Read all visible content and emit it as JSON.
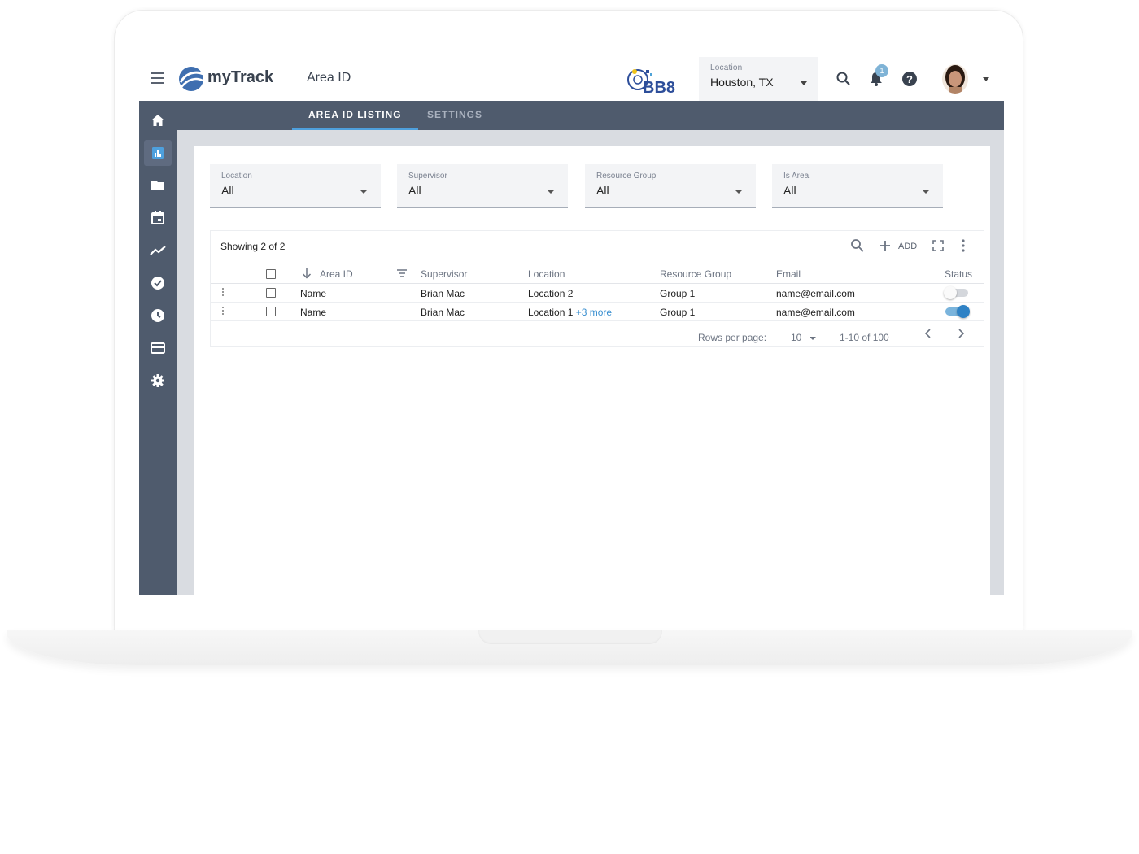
{
  "app": {
    "name": "myTrack",
    "page_title": "Area ID"
  },
  "header": {
    "location_label": "Location",
    "location_value": "Houston, TX",
    "notification_count": "1",
    "partner_logo": "BB8"
  },
  "tabs": [
    {
      "label": "AREA ID LISTING",
      "active": true
    },
    {
      "label": "SETTINGS",
      "active": false
    }
  ],
  "sidebar": {
    "items": [
      {
        "icon": "home-icon",
        "active": false
      },
      {
        "icon": "chart-icon",
        "active": true
      },
      {
        "icon": "folder-icon",
        "active": false
      },
      {
        "icon": "calendar-icon",
        "active": false
      },
      {
        "icon": "trend-icon",
        "active": false
      },
      {
        "icon": "check-circle-icon",
        "active": false
      },
      {
        "icon": "clock-icon",
        "active": false
      },
      {
        "icon": "card-icon",
        "active": false
      },
      {
        "icon": "gear-icon",
        "active": false
      }
    ]
  },
  "filters": [
    {
      "label": "Location",
      "value": "All"
    },
    {
      "label": "Supervisor",
      "value": "All"
    },
    {
      "label": "Resource Group",
      "value": "All"
    },
    {
      "label": "Is Area",
      "value": "All"
    }
  ],
  "table": {
    "showing": "Showing 2 of 2",
    "add_label": "ADD",
    "columns": [
      "Area ID",
      "Supervisor",
      "Location",
      "Resource Group",
      "Email",
      "Status"
    ],
    "rows": [
      {
        "area_id": "Name",
        "supervisor": "Brian Mac",
        "location": "Location 2",
        "location_more": "",
        "group": "Group 1",
        "email": "name@email.com",
        "status": false
      },
      {
        "area_id": "Name",
        "supervisor": "Brian Mac",
        "location": "Location 1",
        "location_more": "+3 more",
        "group": "Group 1",
        "email": "name@email.com",
        "status": true
      }
    ],
    "footer": {
      "rows_per_page_label": "Rows per page:",
      "rows_per_page_value": "10",
      "range": "1-10 of 100"
    }
  },
  "colors": {
    "sidebar": "#4f5b6d",
    "accent": "#4ea0dd",
    "toggle_on": "#2f82c5"
  }
}
